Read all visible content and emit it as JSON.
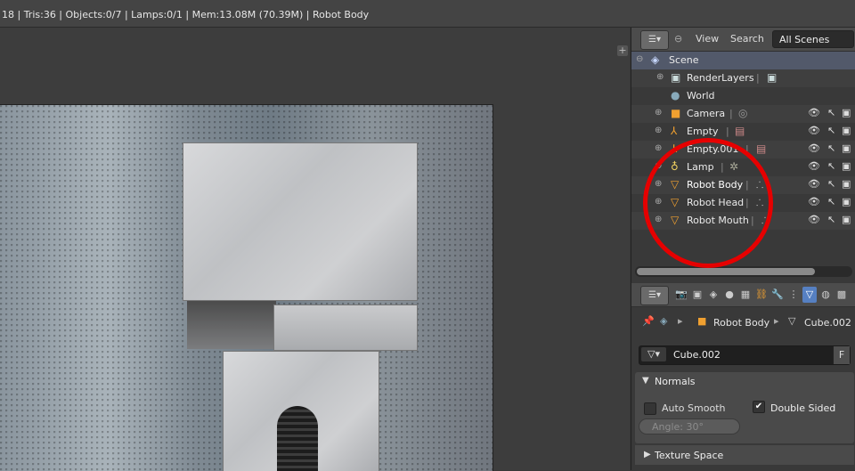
{
  "info_bar": {
    "text": "18 | Tris:36 | Objects:0/7 | Lamps:0/1 | Mem:13.08M (70.39M) | Robot Body"
  },
  "viewport": {
    "plus_icon": "plus-icon"
  },
  "outliner": {
    "header": {
      "view_label": "View",
      "search_label": "Search",
      "display_mode": "All Scenes"
    },
    "scene": {
      "label": "Scene"
    },
    "rows": [
      {
        "label": "RenderLayers",
        "icon": "renderlayers-icon"
      },
      {
        "label": "World",
        "icon": "world-icon"
      },
      {
        "label": "Camera",
        "icon": "camera-icon"
      },
      {
        "label": "Empty",
        "icon": "empty-icon"
      },
      {
        "label": "Empty.001",
        "icon": "empty-icon"
      },
      {
        "label": "Lamp",
        "icon": "lamp-icon"
      },
      {
        "label": "Robot Body",
        "icon": "mesh-icon"
      },
      {
        "label": "Robot Head",
        "icon": "mesh-icon"
      },
      {
        "label": "Robot Mouth",
        "icon": "mesh-icon"
      }
    ]
  },
  "properties": {
    "breadcrumb": {
      "object": "Robot Body",
      "mesh": "Cube.002"
    },
    "data_field": {
      "value": "Cube.002",
      "fake_user": "F"
    },
    "normals": {
      "title": "Normals",
      "auto_smooth": {
        "label": "Auto Smooth",
        "checked": false
      },
      "double_sided": {
        "label": "Double Sided",
        "checked": true
      },
      "angle": "Angle: 30°"
    },
    "texture_space": {
      "title": "Texture Space"
    }
  },
  "annotation": {
    "color": "#e60000"
  },
  "colors": {
    "selected_tab": "#5680c2",
    "mesh_icon": "#f0a030"
  }
}
